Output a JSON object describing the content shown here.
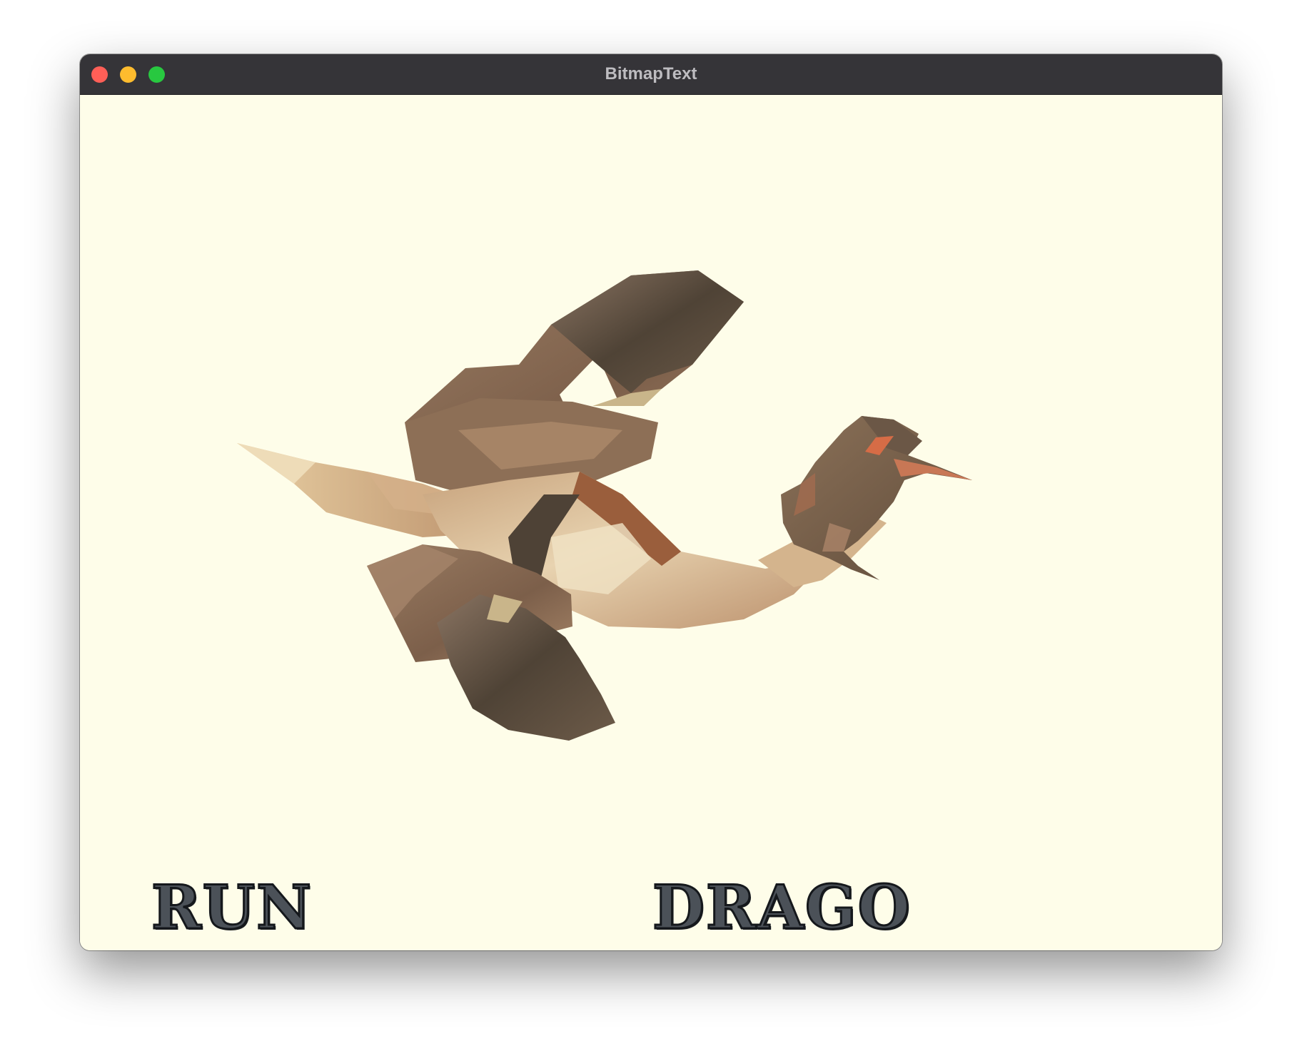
{
  "window": {
    "title": "BitmapText"
  },
  "scene": {
    "background_color": "#fefde9",
    "model": "dragon",
    "bitmap_texts": [
      {
        "text": "RUN"
      },
      {
        "text": "DRAGO"
      }
    ]
  }
}
